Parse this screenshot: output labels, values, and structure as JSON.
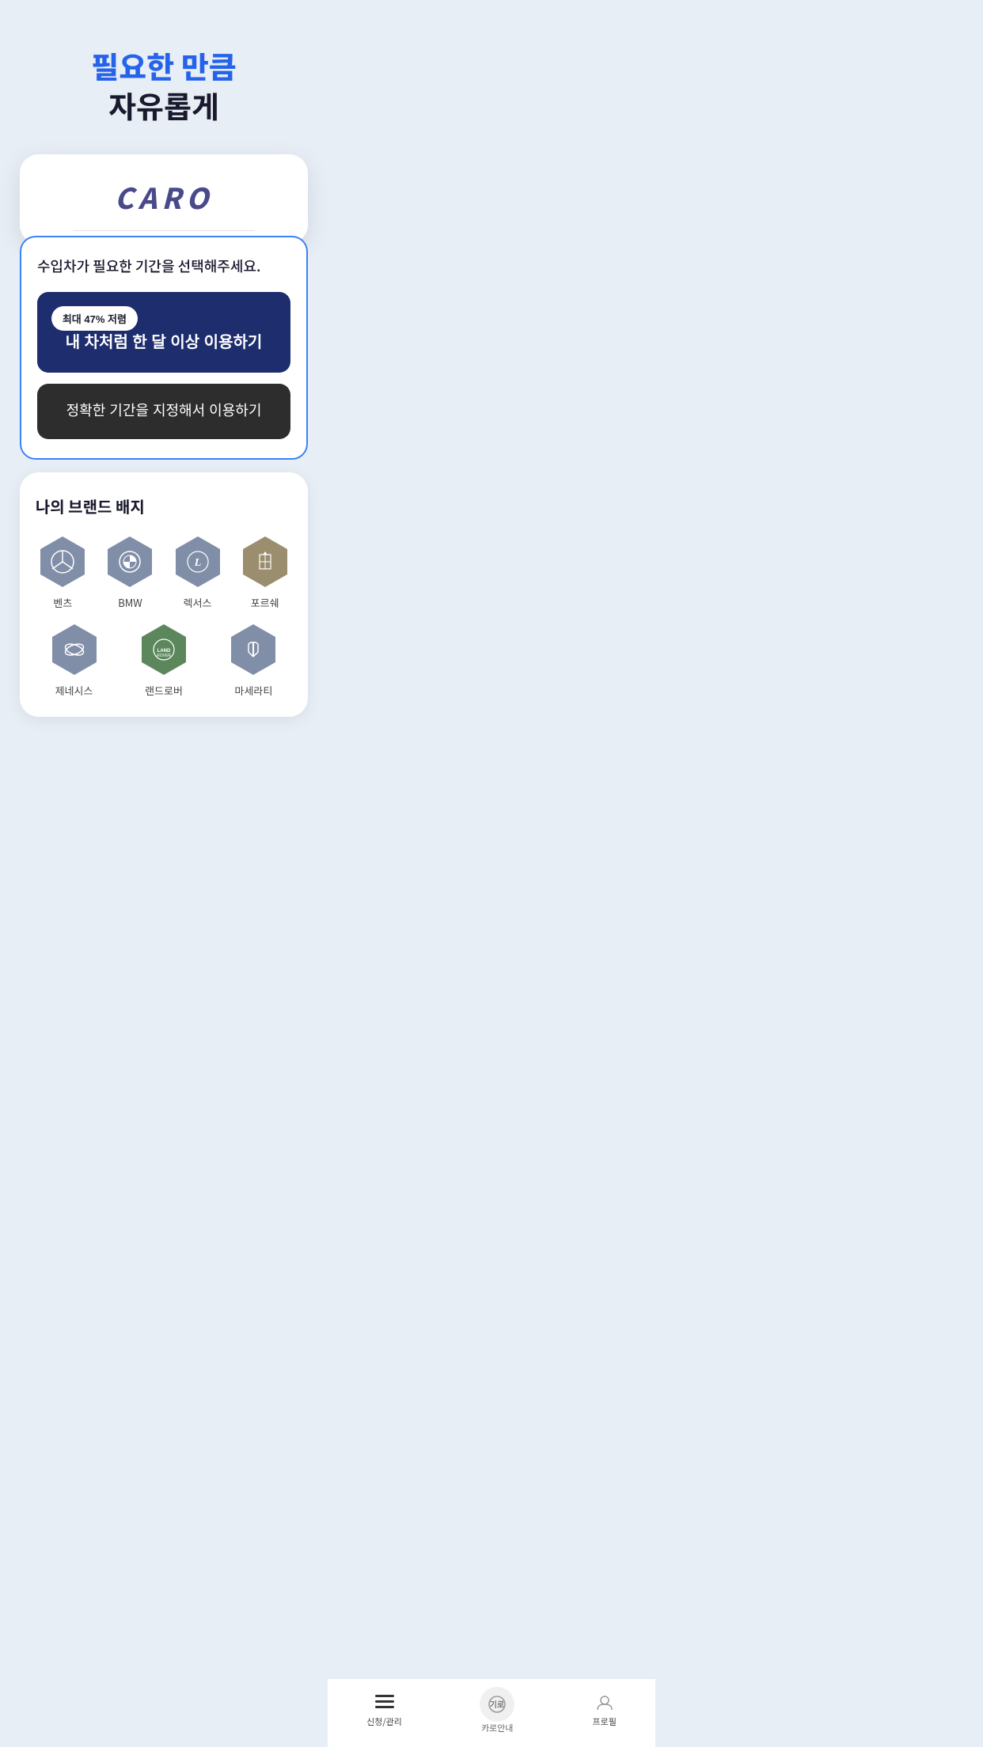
{
  "hero": {
    "line1": "필요한 만큼",
    "line2": "자유롭게"
  },
  "caro": {
    "logo": "CARO"
  },
  "selection": {
    "title": "수입차가 필요한 기간을 선택해주세요.",
    "option1": {
      "badge": "최대 47% 저렴",
      "text": "내 차처럼 한 달 이상 이용하기"
    },
    "option2": {
      "text": "정확한 기간을 지정해서 이용하기"
    }
  },
  "brands": {
    "section_title": "나의 브랜드 배지",
    "row1": [
      {
        "name": "벤츠",
        "color": "#6b7a99"
      },
      {
        "name": "BMW",
        "color": "#6b7a99"
      },
      {
        "name": "렉서스",
        "color": "#6b7a99"
      },
      {
        "name": "포르쉐",
        "color": "#8a7a55"
      }
    ],
    "row2": [
      {
        "name": "제네시스",
        "color": "#6b7a99"
      },
      {
        "name": "랜드로버",
        "color": "#5a7a5a"
      },
      {
        "name": "마세라티",
        "color": "#6b7a99"
      }
    ]
  },
  "bottom_nav": {
    "items": [
      {
        "label": "신청/관리",
        "icon": "list-icon"
      },
      {
        "label": "카로안내",
        "icon": "caro-guide-icon"
      },
      {
        "label": "프로필",
        "icon": "profile-icon"
      }
    ]
  }
}
